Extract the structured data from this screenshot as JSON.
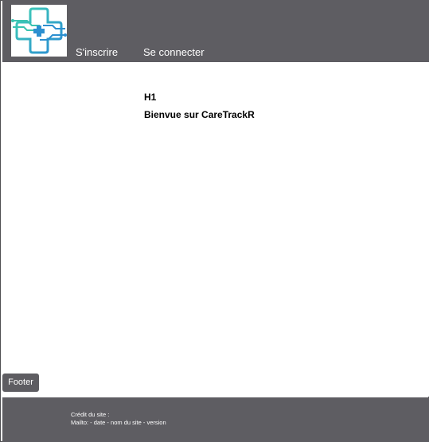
{
  "colors": {
    "header_bg": "#5e5d62",
    "footer_bg": "#5e5d62",
    "logo_teal": "#3bc3b0",
    "logo_blue": "#2c8fd0"
  },
  "header": {
    "logo_icon": "medical-cross-circuit-icon",
    "nav": {
      "signup_label": "S'inscrire",
      "login_label": "Se connecter"
    }
  },
  "main": {
    "heading_tag": "H1",
    "welcome_text": "Bienvue sur CareTrackR"
  },
  "footer": {
    "tag_label": "Footer",
    "credit_text": "Crédit du site :",
    "mailto_text": "Mailto:  - date - nom du site - version"
  }
}
